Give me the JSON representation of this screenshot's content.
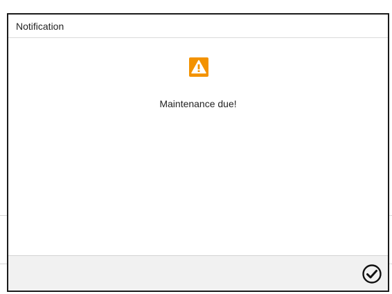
{
  "dialog": {
    "title": "Notification",
    "icon": "warning-icon",
    "message": "Maintenance due!",
    "confirm_icon": "check-circle-icon"
  },
  "colors": {
    "warning": "#f39200",
    "border": "#1a1a1a",
    "footer_bg": "#f1f1f1",
    "text": "#222222"
  }
}
